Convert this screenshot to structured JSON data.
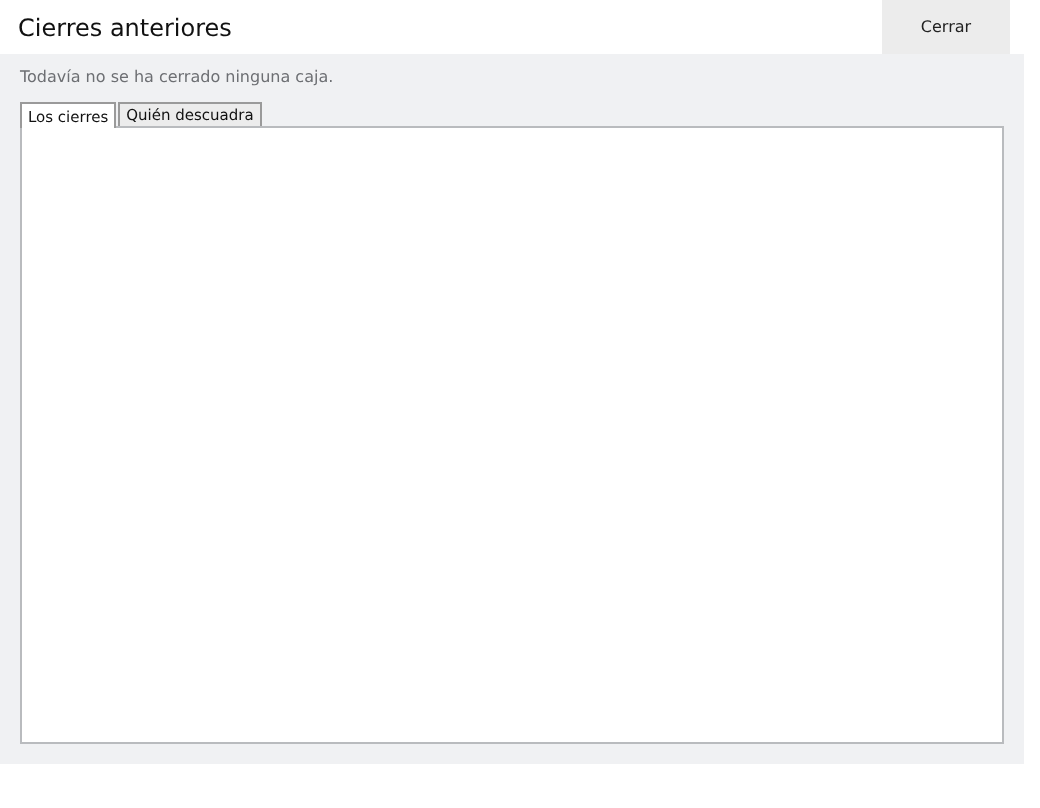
{
  "window": {
    "title": "Cierres anteriores"
  },
  "close_button": {
    "label": "Cerrar"
  },
  "message": "Todavía no se ha cerrado ninguna caja.",
  "tabs": [
    {
      "label": "Los cierres",
      "selected": true
    },
    {
      "label": "Quién descuadra",
      "selected": false
    }
  ]
}
